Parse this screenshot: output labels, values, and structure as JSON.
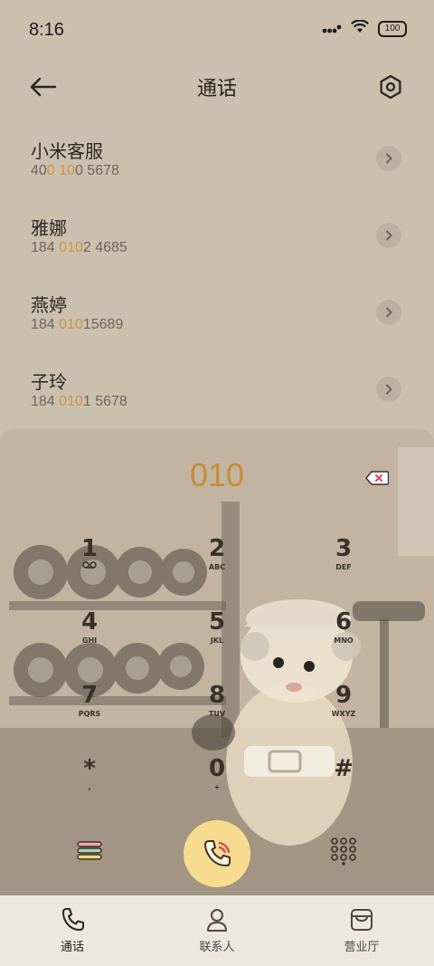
{
  "status_bar": {
    "time": "8:16",
    "battery": "100"
  },
  "header": {
    "title": "通话"
  },
  "contacts": [
    {
      "name": "小米客服",
      "number_parts": [
        "40",
        "0",
        " ",
        "10",
        "0 5678"
      ]
    },
    {
      "name": "雅娜",
      "number_parts": [
        "184 ",
        "010",
        "2 4685"
      ]
    },
    {
      "name": "燕婷",
      "number_parts": [
        "184 ",
        "010",
        "15689"
      ]
    },
    {
      "name": "子玲",
      "number_parts": [
        "184 ",
        "010",
        "1 5678"
      ]
    }
  ],
  "dialpad": {
    "input_value": "010",
    "keys": [
      {
        "digit": "1",
        "letters": ""
      },
      {
        "digit": "2",
        "letters": "ABC"
      },
      {
        "digit": "3",
        "letters": "DEF"
      },
      {
        "digit": "4",
        "letters": "GHI"
      },
      {
        "digit": "5",
        "letters": "JKL"
      },
      {
        "digit": "6",
        "letters": "MNO"
      },
      {
        "digit": "7",
        "letters": "PQRS"
      },
      {
        "digit": "8",
        "letters": "TUV"
      },
      {
        "digit": "9",
        "letters": "WXYZ"
      },
      {
        "digit": "*",
        "letters": ","
      },
      {
        "digit": "0",
        "letters": "+"
      },
      {
        "digit": "#",
        "letters": ""
      }
    ]
  },
  "bottom_nav": {
    "items": [
      {
        "label": "通话",
        "icon": "phone-icon",
        "active": true
      },
      {
        "label": "联系人",
        "icon": "person-icon",
        "active": false
      },
      {
        "label": "营业厅",
        "icon": "store-icon",
        "active": false
      }
    ]
  },
  "colors": {
    "accent": "#c99746",
    "call_button": "#f7dc8f",
    "background": "#cdbfae"
  }
}
